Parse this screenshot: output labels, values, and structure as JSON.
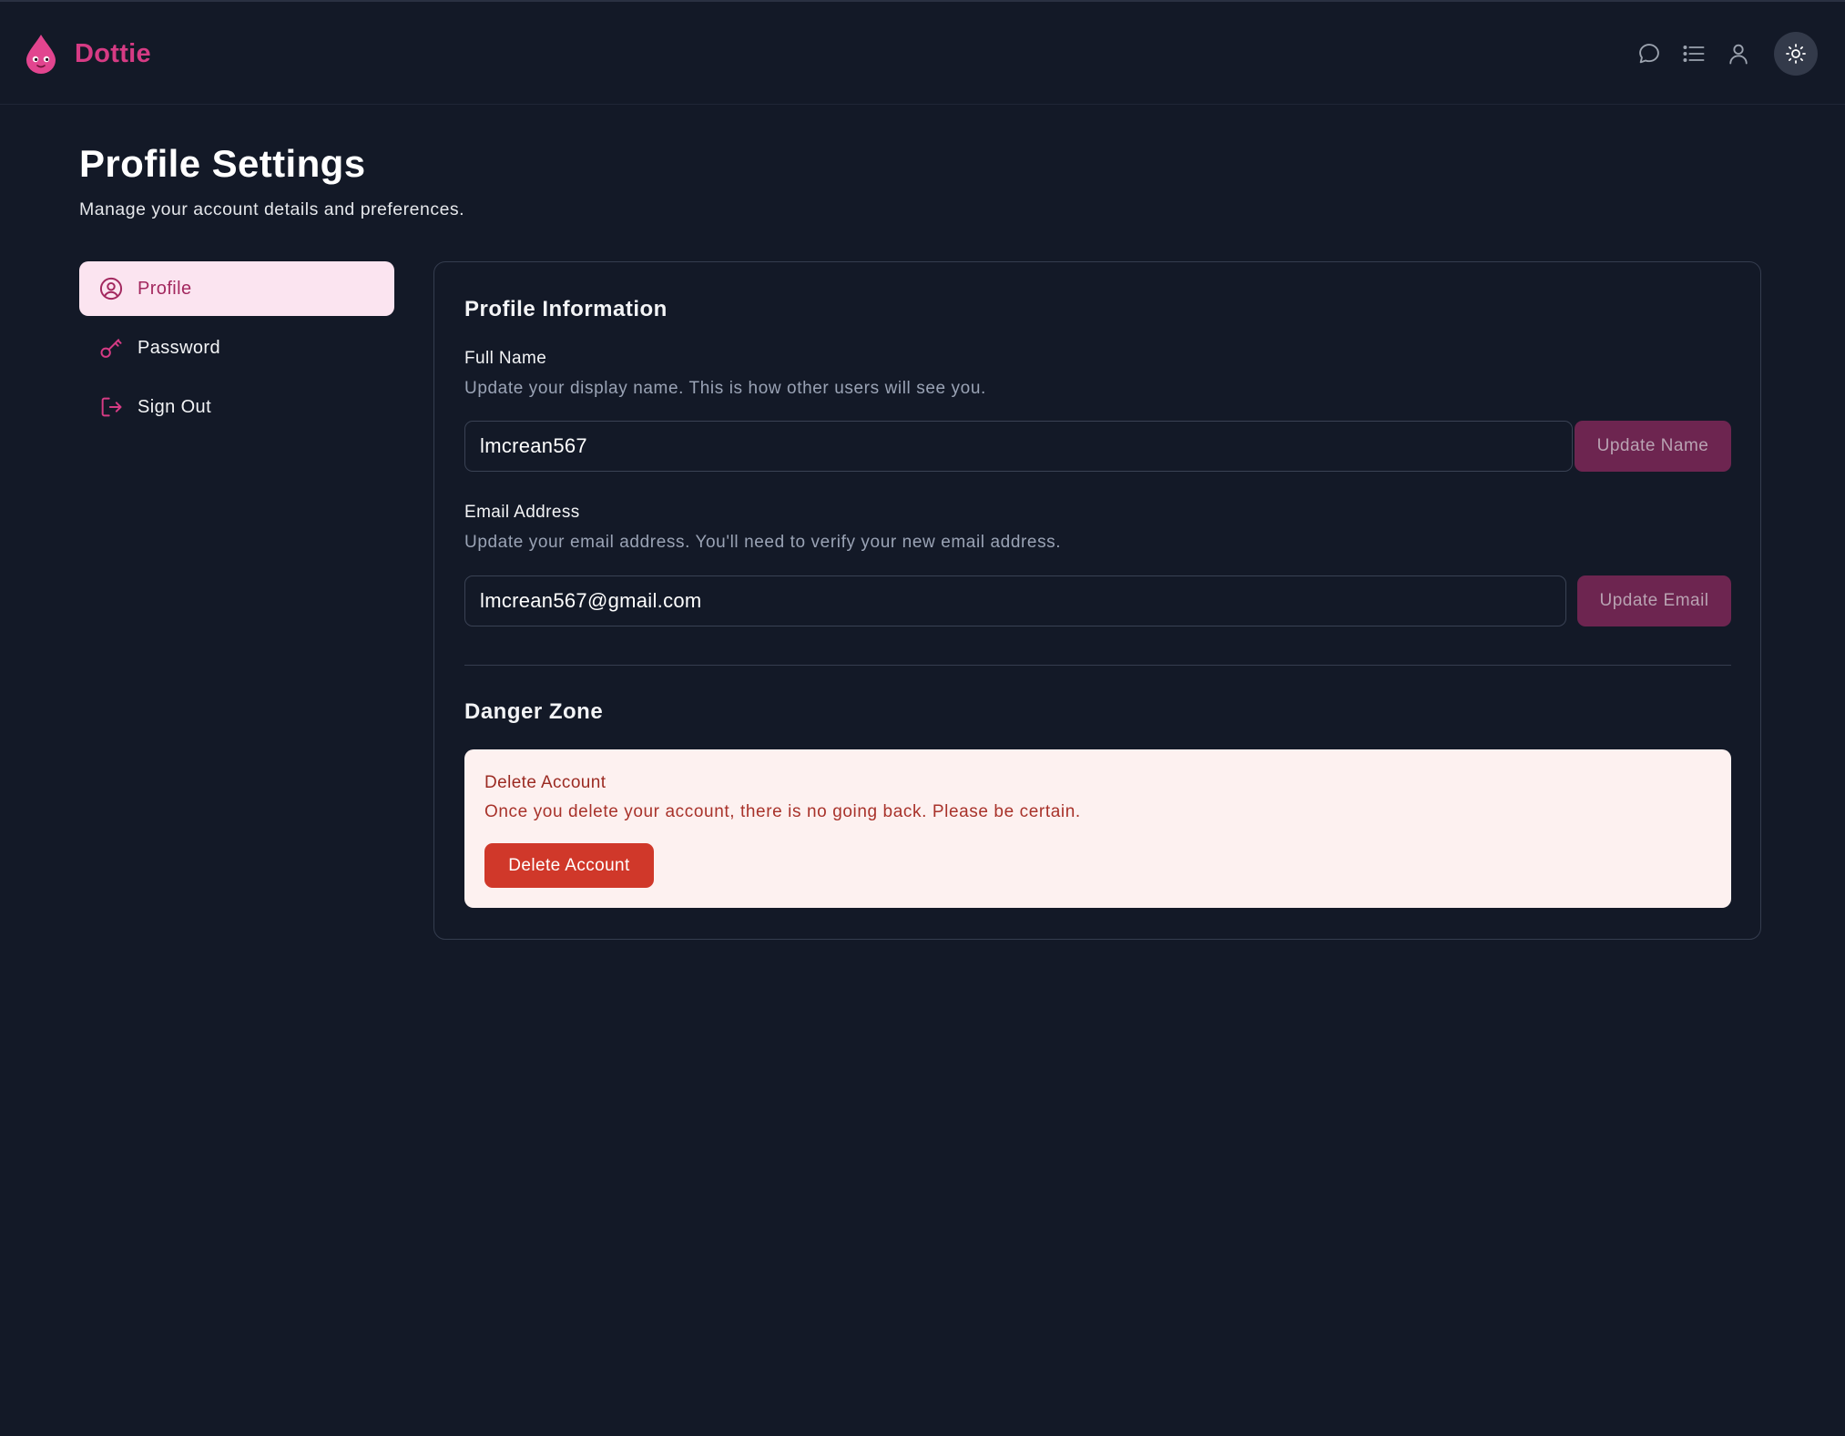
{
  "app": {
    "name": "Dottie",
    "brand_color": "#d63b84"
  },
  "header": {
    "icons": [
      "chat-icon",
      "list-icon",
      "user-icon",
      "sun-icon"
    ]
  },
  "page": {
    "title": "Profile Settings",
    "subtitle": "Manage your account details and preferences."
  },
  "sidebar": {
    "items": [
      {
        "label": "Profile",
        "icon": "user-circle-icon",
        "active": true
      },
      {
        "label": "Password",
        "icon": "key-icon",
        "active": false
      },
      {
        "label": "Sign Out",
        "icon": "sign-out-icon",
        "active": false
      }
    ]
  },
  "profile": {
    "section_title": "Profile Information",
    "name": {
      "label": "Full Name",
      "help": "Update your display name. This is how other users will see you.",
      "value": "lmcrean567",
      "button": "Update Name"
    },
    "email": {
      "label": "Email Address",
      "help": "Update your email address. You'll need to verify your new email address.",
      "value": "lmcrean567@gmail.com",
      "button": "Update Email"
    }
  },
  "danger": {
    "section_title": "Danger Zone",
    "title": "Delete Account",
    "text": "Once you delete your account, there is no going back. Please be certain.",
    "button": "Delete Account",
    "color": "#d0382a"
  }
}
